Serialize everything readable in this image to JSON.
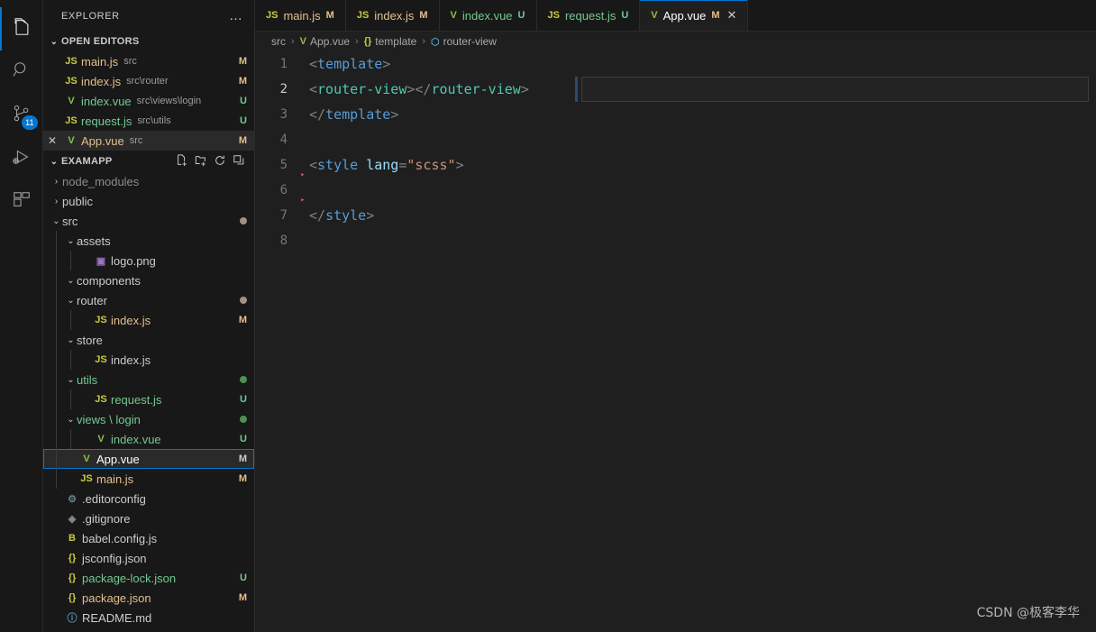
{
  "colors": {
    "accent": "#0078d4",
    "sidebar_bg": "#181818",
    "editor_bg": "#1f1f1f",
    "modified": "#e2c08d",
    "untracked": "#73c991",
    "vue_green": "#8dc149",
    "js_yellow": "#cbcb41"
  },
  "activitybar": {
    "items": [
      {
        "name": "explorer",
        "icon": "files-icon",
        "active": true,
        "badge": ""
      },
      {
        "name": "search",
        "icon": "search-icon",
        "active": false,
        "badge": ""
      },
      {
        "name": "source-control",
        "icon": "source-control-icon",
        "active": false,
        "badge": "11"
      },
      {
        "name": "run-and-debug",
        "icon": "run-debug-icon",
        "active": false,
        "badge": ""
      },
      {
        "name": "extensions",
        "icon": "extensions-icon",
        "active": false,
        "badge": ""
      }
    ]
  },
  "sidebar": {
    "title": "EXPLORER",
    "more_actions": "…",
    "open_editors": {
      "label": "OPEN EDITORS",
      "chevron": "⌄",
      "items": [
        {
          "icon": "JS",
          "icon_class": "js",
          "name": "main.js",
          "sub": "src",
          "status": "M",
          "status_color": "#e2c08d",
          "name_color": "#e2c08d",
          "active": false
        },
        {
          "icon": "JS",
          "icon_class": "js",
          "name": "index.js",
          "sub": "src\\router",
          "status": "M",
          "status_color": "#e2c08d",
          "name_color": "#e2c08d",
          "active": false
        },
        {
          "icon": "V",
          "icon_class": "vue",
          "name": "index.vue",
          "sub": "src\\views\\login",
          "status": "U",
          "status_color": "#73c991",
          "name_color": "#73c991",
          "active": false
        },
        {
          "icon": "JS",
          "icon_class": "js",
          "name": "request.js",
          "sub": "src\\utils",
          "status": "U",
          "status_color": "#73c991",
          "name_color": "#73c991",
          "active": false
        },
        {
          "icon": "V",
          "icon_class": "vue",
          "name": "App.vue",
          "sub": "src",
          "status": "M",
          "status_color": "#e2c08d",
          "name_color": "#e2c08d",
          "active": true
        }
      ]
    },
    "project": {
      "label": "EXAMAPP",
      "chevron": "⌄",
      "actions": [
        "new-file-icon",
        "new-folder-icon",
        "refresh-icon",
        "collapse-all-icon"
      ],
      "tree": [
        {
          "depth": 0,
          "chev": "›",
          "icon": "",
          "icon_class": "",
          "name": "node_modules",
          "name_color": "#8b8b8b",
          "status": "",
          "status_color": "",
          "dot": "",
          "selected": false
        },
        {
          "depth": 0,
          "chev": "›",
          "icon": "",
          "icon_class": "",
          "name": "public",
          "name_color": "#cccccc",
          "status": "",
          "status_color": "",
          "dot": "",
          "selected": false
        },
        {
          "depth": 0,
          "chev": "⌄",
          "icon": "",
          "icon_class": "",
          "name": "src",
          "name_color": "#cccccc",
          "status": "",
          "status_color": "",
          "dot": "#a39281",
          "selected": false
        },
        {
          "depth": 1,
          "chev": "⌄",
          "icon": "",
          "icon_class": "",
          "name": "assets",
          "name_color": "#cccccc",
          "status": "",
          "status_color": "",
          "dot": "",
          "selected": false
        },
        {
          "depth": 2,
          "chev": "",
          "icon": "▣",
          "icon_class": "png",
          "name": "logo.png",
          "name_color": "#cccccc",
          "status": "",
          "status_color": "",
          "dot": "",
          "selected": false
        },
        {
          "depth": 1,
          "chev": "⌄",
          "icon": "",
          "icon_class": "",
          "name": "components",
          "name_color": "#cccccc",
          "status": "",
          "status_color": "",
          "dot": "",
          "selected": false
        },
        {
          "depth": 1,
          "chev": "⌄",
          "icon": "",
          "icon_class": "",
          "name": "router",
          "name_color": "#cccccc",
          "status": "",
          "status_color": "",
          "dot": "#a39281",
          "selected": false
        },
        {
          "depth": 2,
          "chev": "",
          "icon": "JS",
          "icon_class": "js",
          "name": "index.js",
          "name_color": "#e2c08d",
          "status": "M",
          "status_color": "#e2c08d",
          "dot": "",
          "selected": false
        },
        {
          "depth": 1,
          "chev": "⌄",
          "icon": "",
          "icon_class": "",
          "name": "store",
          "name_color": "#cccccc",
          "status": "",
          "status_color": "",
          "dot": "",
          "selected": false
        },
        {
          "depth": 2,
          "chev": "",
          "icon": "JS",
          "icon_class": "js",
          "name": "index.js",
          "name_color": "#cccccc",
          "status": "",
          "status_color": "",
          "dot": "",
          "selected": false
        },
        {
          "depth": 1,
          "chev": "⌄",
          "icon": "",
          "icon_class": "",
          "name": "utils",
          "name_color": "#73c991",
          "status": "",
          "status_color": "",
          "dot": "#4f9153",
          "selected": false
        },
        {
          "depth": 2,
          "chev": "",
          "icon": "JS",
          "icon_class": "js",
          "name": "request.js",
          "name_color": "#73c991",
          "status": "U",
          "status_color": "#73c991",
          "dot": "",
          "selected": false
        },
        {
          "depth": 1,
          "chev": "⌄",
          "icon": "",
          "icon_class": "",
          "name": "views \\ login",
          "name_color": "#73c991",
          "status": "",
          "status_color": "",
          "dot": "#4f9153",
          "selected": false
        },
        {
          "depth": 2,
          "chev": "",
          "icon": "V",
          "icon_class": "vue",
          "name": "index.vue",
          "name_color": "#73c991",
          "status": "U",
          "status_color": "#73c991",
          "dot": "",
          "selected": false
        },
        {
          "depth": 1,
          "chev": "",
          "icon": "V",
          "icon_class": "vue",
          "name": "App.vue",
          "name_color": "#ffffff",
          "status": "M",
          "status_color": "#cccccc",
          "dot": "",
          "selected": true
        },
        {
          "depth": 1,
          "chev": "",
          "icon": "JS",
          "icon_class": "js",
          "name": "main.js",
          "name_color": "#e2c08d",
          "status": "M",
          "status_color": "#e2c08d",
          "dot": "",
          "selected": false
        },
        {
          "depth": 0,
          "chev": "",
          "icon": "⚙",
          "icon_class": "cog",
          "name": ".editorconfig",
          "name_color": "#cccccc",
          "status": "",
          "status_color": "",
          "dot": "",
          "selected": false
        },
        {
          "depth": 0,
          "chev": "",
          "icon": "◈",
          "icon_class": "git",
          "name": ".gitignore",
          "name_color": "#cccccc",
          "status": "",
          "status_color": "",
          "dot": "",
          "selected": false
        },
        {
          "depth": 0,
          "chev": "",
          "icon": "B",
          "icon_class": "bab",
          "name": "babel.config.js",
          "name_color": "#cccccc",
          "status": "",
          "status_color": "",
          "dot": "",
          "selected": false
        },
        {
          "depth": 0,
          "chev": "",
          "icon": "{}",
          "icon_class": "brace",
          "name": "jsconfig.json",
          "name_color": "#cccccc",
          "status": "",
          "status_color": "",
          "dot": "",
          "selected": false
        },
        {
          "depth": 0,
          "chev": "",
          "icon": "{}",
          "icon_class": "brace",
          "name": "package-lock.json",
          "name_color": "#73c991",
          "status": "U",
          "status_color": "#73c991",
          "dot": "",
          "selected": false
        },
        {
          "depth": 0,
          "chev": "",
          "icon": "{}",
          "icon_class": "brace",
          "name": "package.json",
          "name_color": "#e2c08d",
          "status": "M",
          "status_color": "#e2c08d",
          "dot": "",
          "selected": false
        },
        {
          "depth": 0,
          "chev": "",
          "icon": "ⓘ",
          "icon_class": "md",
          "name": "README.md",
          "name_color": "#cccccc",
          "status": "",
          "status_color": "",
          "dot": "",
          "selected": false
        }
      ]
    }
  },
  "tabs": [
    {
      "icon": "JS",
      "icon_class": "js",
      "label": "main.js",
      "status": "M",
      "active": false,
      "closable": false
    },
    {
      "icon": "JS",
      "icon_class": "js",
      "label": "index.js",
      "status": "M",
      "active": false,
      "closable": false
    },
    {
      "icon": "V",
      "icon_class": "vue",
      "label": "index.vue",
      "status": "U",
      "active": false,
      "closable": false
    },
    {
      "icon": "JS",
      "icon_class": "js",
      "label": "request.js",
      "status": "U",
      "active": false,
      "closable": false
    },
    {
      "icon": "V",
      "icon_class": "vue",
      "label": "App.vue",
      "status": "M",
      "active": true,
      "closable": true,
      "close_glyph": "✕"
    }
  ],
  "breadcrumb": [
    {
      "icon": "",
      "icon_class": "",
      "label": "src"
    },
    {
      "icon": "V",
      "icon_class": "vue",
      "label": "App.vue"
    },
    {
      "icon": "{}",
      "icon_class": "brace",
      "label": "template"
    },
    {
      "icon": "⬡",
      "icon_class": "md",
      "label": "router-view"
    }
  ],
  "code": {
    "lines": [
      {
        "n": "1",
        "current": false,
        "fold_below": false,
        "tokens": [
          {
            "t": "<",
            "c": "t-punct"
          },
          {
            "t": "template",
            "c": "t-tag"
          },
          {
            "t": ">",
            "c": "t-punct"
          }
        ]
      },
      {
        "n": "2",
        "current": true,
        "fold_below": false,
        "tokens": [
          {
            "t": "<",
            "c": "t-punct"
          },
          {
            "t": "router-view",
            "c": "t-comp"
          },
          {
            "t": "></",
            "c": "t-punct"
          },
          {
            "t": "router-view",
            "c": "t-comp"
          },
          {
            "t": ">",
            "c": "t-punct"
          }
        ]
      },
      {
        "n": "3",
        "current": false,
        "fold_below": false,
        "tokens": [
          {
            "t": "</",
            "c": "t-punct"
          },
          {
            "t": "template",
            "c": "t-tag"
          },
          {
            "t": ">",
            "c": "t-punct"
          }
        ]
      },
      {
        "n": "4",
        "current": false,
        "fold_below": false,
        "tokens": []
      },
      {
        "n": "5",
        "current": false,
        "fold_below": true,
        "tokens": [
          {
            "t": "<",
            "c": "t-punct"
          },
          {
            "t": "style",
            "c": "t-tag"
          },
          {
            "t": " ",
            "c": "t-punct"
          },
          {
            "t": "lang",
            "c": "t-attr"
          },
          {
            "t": "=",
            "c": "t-punct"
          },
          {
            "t": "\"scss\"",
            "c": "t-str"
          },
          {
            "t": ">",
            "c": "t-punct"
          }
        ]
      },
      {
        "n": "6",
        "current": false,
        "fold_below": true,
        "tokens": []
      },
      {
        "n": "7",
        "current": false,
        "fold_below": false,
        "tokens": [
          {
            "t": "</",
            "c": "t-punct"
          },
          {
            "t": "style",
            "c": "t-tag"
          },
          {
            "t": ">",
            "c": "t-punct"
          }
        ]
      },
      {
        "n": "8",
        "current": false,
        "fold_below": false,
        "tokens": []
      }
    ]
  },
  "watermark": "CSDN @极客李华"
}
